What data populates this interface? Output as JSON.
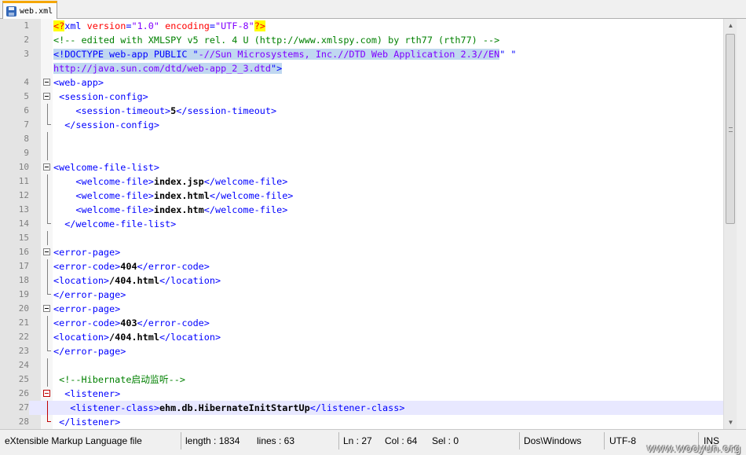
{
  "tab": {
    "filename": "web.xml",
    "icon": "save-disk-icon"
  },
  "lines": [
    {
      "n": "1",
      "fold": "none",
      "parts": [
        [
          "pi",
          "<?"
        ],
        [
          "t",
          "xml "
        ],
        [
          "a",
          "version"
        ],
        [
          "t",
          "="
        ],
        [
          "v",
          "\"1.0\""
        ],
        [
          "t",
          " "
        ],
        [
          "a",
          "encoding"
        ],
        [
          "t",
          "="
        ],
        [
          "v",
          "\"UTF-8\""
        ],
        [
          "pi",
          "?>"
        ]
      ]
    },
    {
      "n": "2",
      "fold": "none",
      "parts": [
        [
          "c",
          "<!-- edited with XMLSPY v5 rel. 4 U (http://www.xmlspy.com) by rth77 (rth77) -->"
        ]
      ]
    },
    {
      "n": "3",
      "fold": "none",
      "parts": [
        [
          "d sel",
          "<!DOCTYPE web-app PUBLIC \""
        ],
        [
          "v sel",
          "-//Sun Microsystems, Inc.//DTD Web Application 2.3//EN"
        ],
        [
          "d",
          "\" \""
        ]
      ]
    },
    {
      "n": "",
      "fold": "none",
      "parts": [
        [
          "v sel",
          "http://java.sun.com/dtd/web-app_2_3.dtd"
        ],
        [
          "d sel",
          "\">"
        ]
      ]
    },
    {
      "n": "4",
      "fold": "open",
      "parts": [
        [
          "t",
          "<web-app>"
        ]
      ]
    },
    {
      "n": "5",
      "fold": "open",
      "parts": [
        [
          "t",
          " <session-config>"
        ]
      ]
    },
    {
      "n": "6",
      "fold": "line",
      "parts": [
        [
          "t",
          "    <session-timeout>"
        ],
        [
          "x",
          "5"
        ],
        [
          "t",
          "</session-timeout>"
        ]
      ]
    },
    {
      "n": "7",
      "fold": "end",
      "parts": [
        [
          "t",
          "  </session-config>"
        ]
      ]
    },
    {
      "n": "8",
      "fold": "line",
      "parts": []
    },
    {
      "n": "9",
      "fold": "line",
      "parts": []
    },
    {
      "n": "10",
      "fold": "open",
      "parts": [
        [
          "t",
          "<welcome-file-list>"
        ]
      ]
    },
    {
      "n": "11",
      "fold": "line",
      "parts": [
        [
          "t",
          "    <welcome-file>"
        ],
        [
          "x",
          "index.jsp"
        ],
        [
          "t",
          "</welcome-file>"
        ]
      ]
    },
    {
      "n": "12",
      "fold": "line",
      "parts": [
        [
          "t",
          "    <welcome-file>"
        ],
        [
          "x",
          "index.html"
        ],
        [
          "t",
          "</welcome-file>"
        ]
      ]
    },
    {
      "n": "13",
      "fold": "line",
      "parts": [
        [
          "t",
          "    <welcome-file>"
        ],
        [
          "x",
          "index.htm"
        ],
        [
          "t",
          "</welcome-file>"
        ]
      ]
    },
    {
      "n": "14",
      "fold": "end",
      "parts": [
        [
          "t",
          "  </welcome-file-list>"
        ]
      ]
    },
    {
      "n": "15",
      "fold": "line",
      "parts": []
    },
    {
      "n": "16",
      "fold": "open",
      "parts": [
        [
          "t",
          "<error-page>"
        ]
      ]
    },
    {
      "n": "17",
      "fold": "line",
      "parts": [
        [
          "t",
          "<error-code>"
        ],
        [
          "x",
          "404"
        ],
        [
          "t",
          "</error-code>"
        ]
      ]
    },
    {
      "n": "18",
      "fold": "line",
      "parts": [
        [
          "t",
          "<location>"
        ],
        [
          "x",
          "/404.html"
        ],
        [
          "t",
          "</location>"
        ]
      ]
    },
    {
      "n": "19",
      "fold": "end",
      "parts": [
        [
          "t",
          "</error-page>"
        ]
      ]
    },
    {
      "n": "20",
      "fold": "open",
      "parts": [
        [
          "t",
          "<error-page>"
        ]
      ]
    },
    {
      "n": "21",
      "fold": "line",
      "parts": [
        [
          "t",
          "<error-code>"
        ],
        [
          "x",
          "403"
        ],
        [
          "t",
          "</error-code>"
        ]
      ]
    },
    {
      "n": "22",
      "fold": "line",
      "parts": [
        [
          "t",
          "<location>"
        ],
        [
          "x",
          "/404.html"
        ],
        [
          "t",
          "</location>"
        ]
      ]
    },
    {
      "n": "23",
      "fold": "end",
      "parts": [
        [
          "t",
          "</error-page>"
        ]
      ]
    },
    {
      "n": "24",
      "fold": "line",
      "parts": []
    },
    {
      "n": "25",
      "fold": "line",
      "parts": [
        [
          "c",
          " <!--Hibernate启动监听-->"
        ]
      ]
    },
    {
      "n": "26",
      "fold": "open-red",
      "parts": [
        [
          "t",
          "  <listener>"
        ]
      ]
    },
    {
      "n": "27",
      "fold": "line-red",
      "current": true,
      "parts": [
        [
          "t",
          "   <listener-class>"
        ],
        [
          "x",
          "ehm.db.HibernateInitStartUp"
        ],
        [
          "t",
          "</listener-class>"
        ]
      ]
    },
    {
      "n": "28",
      "fold": "end-red",
      "parts": [
        [
          "t",
          " </listener>"
        ]
      ]
    }
  ],
  "status": {
    "language": "eXtensible Markup Language file",
    "length": "length : 1834",
    "lines": "lines : 63",
    "ln": "Ln : 27",
    "col": "Col : 64",
    "sel": "Sel : 0",
    "eol": "Dos\\Windows",
    "encoding": "UTF-8",
    "mode": "INS"
  },
  "watermark": "www.wooyun.org"
}
